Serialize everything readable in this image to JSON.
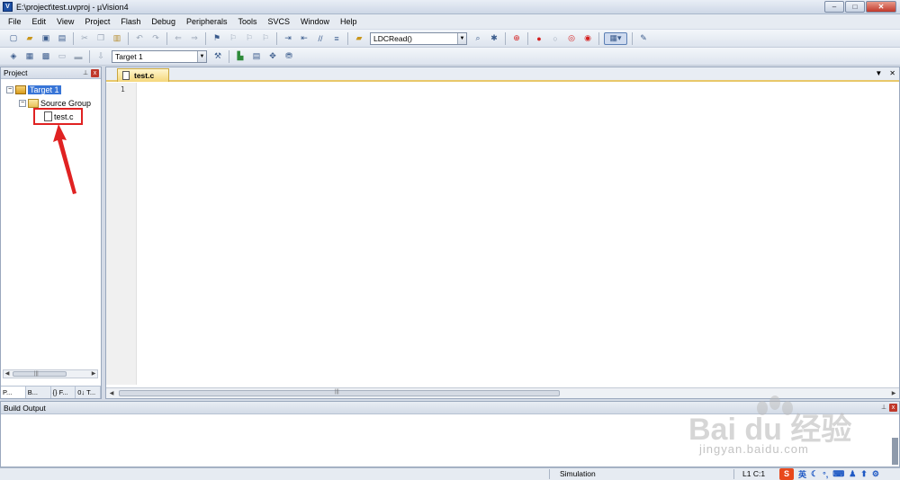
{
  "window": {
    "title": "E:\\project\\test.uvproj - µVision4",
    "minimize": "–",
    "maximize": "□",
    "close": "✕"
  },
  "menu": [
    "File",
    "Edit",
    "View",
    "Project",
    "Flash",
    "Debug",
    "Peripherals",
    "Tools",
    "SVCS",
    "Window",
    "Help"
  ],
  "toolbar1": {
    "function_combo": "LDCRead()"
  },
  "toolbar2": {
    "target_combo": "Target 1"
  },
  "project_panel": {
    "title": "Project",
    "pin": "⊥",
    "close": "x",
    "tree": {
      "target": "Target 1",
      "group": "Source Group",
      "file": "test.c",
      "expand_target": "−",
      "expand_group": "−"
    },
    "tabs": [
      "P...",
      "B...",
      "{} F...",
      "0↓ T..."
    ],
    "grip": "|||"
  },
  "editor": {
    "tab": "test.c",
    "line_number": "1",
    "dropdown": "▼",
    "close": "✕",
    "grip": "|||"
  },
  "build_output": {
    "title": "Build Output",
    "pin": "⊥",
    "close": "x"
  },
  "status": {
    "mode": "Simulation",
    "position": "L1 C:1",
    "ime_logo": "S",
    "ime_lang": "英"
  },
  "watermark": {
    "brand": "Bai  du 经验",
    "url": "jingyan.baidu.com"
  },
  "colors": {
    "highlight": "#e02222",
    "selection": "#3875d7",
    "tab_active": "#f5d77b"
  }
}
